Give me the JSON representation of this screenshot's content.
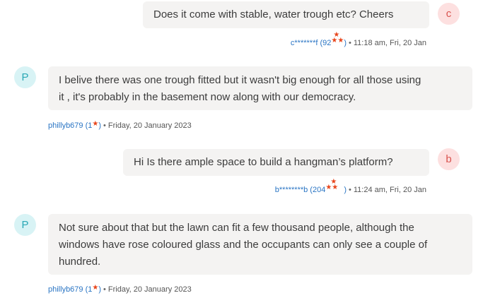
{
  "colors": {
    "bubble_bg": "#f4f3f2",
    "user_link": "#2a75c4",
    "star": "#e8461c",
    "avatar_c_bg": "#fde0e0",
    "avatar_c_fg": "#d9534f",
    "avatar_p_bg": "#d8f3f5",
    "avatar_p_fg": "#2aa8b5"
  },
  "messages": [
    {
      "avatar": "c",
      "text": "Does it come with stable, water trough etc? Cheers",
      "user": "c*******f",
      "score": "92",
      "stars_icon": "star-icon",
      "time": "11:18 am, Fri, 20 Jan"
    },
    {
      "avatar": "P",
      "text_line1": "I belive there was one trough fitted but it wasn't big enough for all those using",
      "text_line2": "it , it's probably in the basement now along with our democracy.",
      "user": "phillyb679",
      "score": "1",
      "stars_icon": "star-icon",
      "time": "Friday, 20 January 2023"
    },
    {
      "avatar": "b",
      "text": "Hi Is there ample space to build a hangman’s platform?",
      "user": "b********b",
      "score": "204",
      "stars_icon": "star-icon",
      "time": "11:24 am, Fri, 20 Jan"
    },
    {
      "avatar": "P",
      "text_line1": "Not sure about that but the lawn can fit a few thousand people, although the",
      "text_line2": "windows have rose coloured glass and the occupants can only see a couple of",
      "text_line3": "hundred.",
      "user": "phillyb679",
      "score": "1",
      "stars_icon": "star-icon",
      "time": "Friday, 20 January 2023"
    }
  ],
  "separator": "•"
}
